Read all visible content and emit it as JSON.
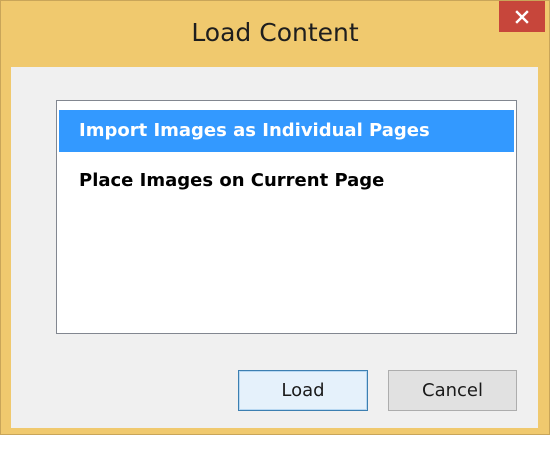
{
  "window": {
    "title": "Load Content",
    "close_icon": "close-icon"
  },
  "list": {
    "items": [
      {
        "label": "Import Images as Individual Pages",
        "selected": true
      },
      {
        "label": "Place Images on Current Page",
        "selected": false
      }
    ]
  },
  "buttons": {
    "load_label": "Load",
    "cancel_label": "Cancel"
  },
  "colors": {
    "frame": "#f0c96e",
    "close": "#c7463b",
    "selection": "#3399ff",
    "default_button_border": "#3c7fb1"
  }
}
